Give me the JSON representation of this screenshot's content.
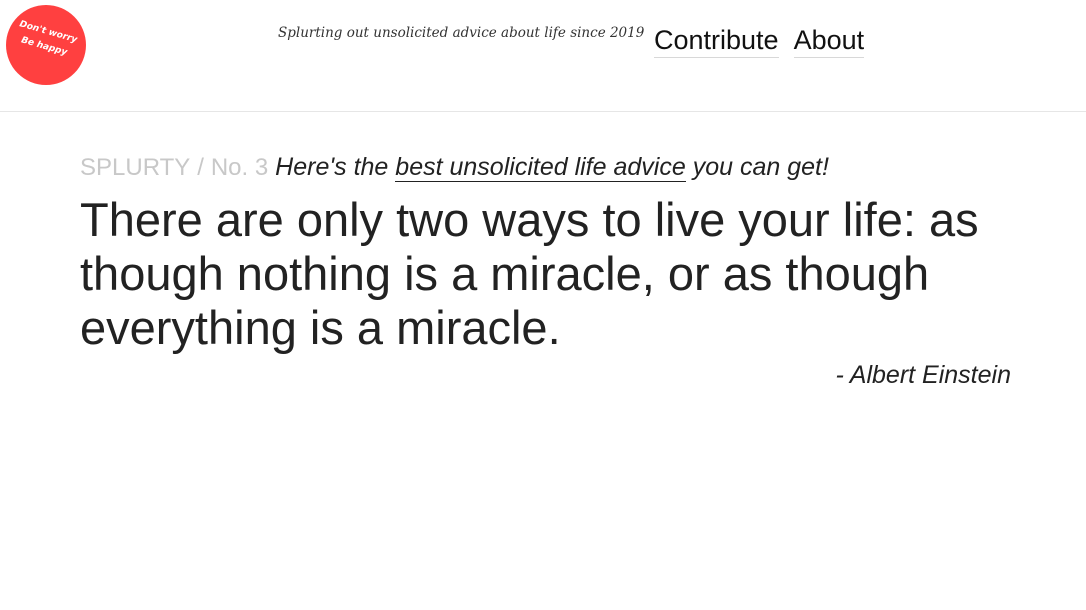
{
  "header": {
    "logo": {
      "line1": "Don't worry",
      "line2": "Be happy",
      "color": "#ff4040"
    },
    "tagline": "Splurting out unsolicited advice about life since 2019",
    "nav": [
      {
        "label": "Contribute"
      },
      {
        "label": "About"
      }
    ]
  },
  "main": {
    "brand": "SPLURTY",
    "separator": "/",
    "number": "No. 3",
    "intro_prefix": "Here's the",
    "intro_link": "best unsolicited life advice",
    "intro_suffix": "you can get!",
    "quote": "There are only two ways to live your life: as though nothing is a miracle, or as though everything is a miracle.",
    "author": "- Albert Einstein"
  },
  "colors": {
    "accent": "#ff4040",
    "text": "#222222",
    "muted": "#c8c8c8"
  }
}
